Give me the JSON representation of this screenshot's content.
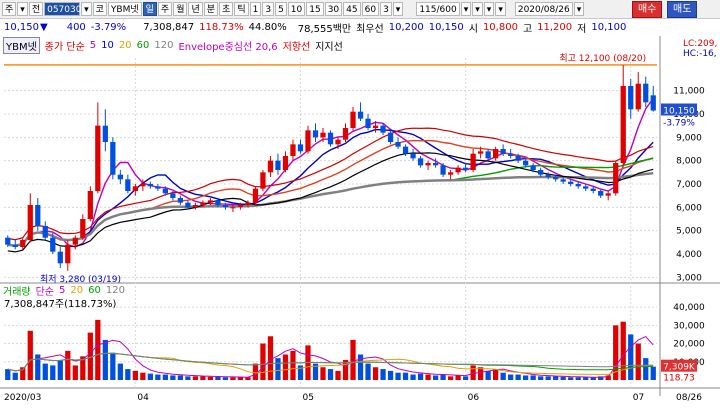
{
  "toolbar": {
    "items": [
      "주",
      "▾",
      "전",
      "057030",
      "▾",
      "코",
      "YBM넷",
      "일",
      "주",
      "월",
      "년",
      "분",
      "초",
      "틱",
      "1",
      "3",
      "5",
      "10",
      "15",
      "30",
      "45",
      "60",
      "3",
      "▾",
      "115/600",
      "▾",
      "▾",
      "▾",
      "▾",
      "2020/08/26",
      "▾"
    ],
    "period_value": "1",
    "date": "2020/08/26",
    "buy_label": "매수",
    "sell_label": "매도"
  },
  "quote": {
    "price": "10,150",
    "arrow": "▼",
    "change": "400",
    "change_pct": "-3.79%",
    "volume": "7,308,847",
    "volume_pct": "118.73%",
    "turnover": "44.80%",
    "amount": "78,555백만",
    "best_label": "최우선",
    "best_ask": "10,200",
    "best_bid": "10,150",
    "open_label": "시",
    "open": "10,800",
    "high_label": "고",
    "high": "11,200",
    "low_label": "저",
    "low": "10,100"
  },
  "price_legend": {
    "name": "YBM넷",
    "ma_label": "종가 단순",
    "ma_periods": [
      "5",
      "10",
      "20",
      "60",
      "120"
    ],
    "ma_colors": [
      "#c000c0",
      "#0000c8",
      "#e0a000",
      "#00a000",
      "#808080"
    ],
    "envelope_label": "Envelope중심선 20,6",
    "resistance_label": "저항선",
    "support_label": "지지선"
  },
  "volume_legend": {
    "label": "거래량",
    "ma_label": "단순",
    "ma_periods": [
      "5",
      "20",
      "60",
      "120"
    ],
    "value": "7,308,847주(118.73%)"
  },
  "annotations": {
    "high_note": "최고 12,100 (08/20)",
    "low_note": "최저 3,280 (03/19)",
    "lc_label": "LC:209,",
    "hc_label": "HC:-16,",
    "current_price_tag": "10,150",
    "current_pct_tag": "-3.79%",
    "volume_tag": "7,309K",
    "volume_pct_tag": "118.73"
  },
  "axis": {
    "price_ticks": [
      "11,000",
      "10,000",
      "9,000",
      "8,000",
      "7,000",
      "6,000",
      "5,000",
      "4,000",
      "3,000"
    ],
    "volume_ticks": [
      "40,000",
      "30,000",
      "20,000",
      "10,000"
    ],
    "date_ticks": [
      "2020/03",
      "04",
      "05",
      "06",
      "07",
      "08",
      "08/26"
    ]
  },
  "chart_data": {
    "type": "candlestick",
    "ylim": [
      2800,
      12400
    ],
    "volume_ylim": [
      0,
      45000
    ],
    "note": "daily OHLC (KRW), volume in thousand shares",
    "candles": [
      [
        4700,
        4800,
        4300,
        4400,
        6000
      ],
      [
        4400,
        4600,
        4200,
        4300,
        4000
      ],
      [
        4300,
        4700,
        4200,
        4600,
        7000
      ],
      [
        4600,
        6600,
        4500,
        6100,
        27000
      ],
      [
        6100,
        6400,
        5000,
        5200,
        14000
      ],
      [
        5200,
        5400,
        4600,
        4700,
        9000
      ],
      [
        4700,
        4900,
        4000,
        4100,
        8000
      ],
      [
        4100,
        4300,
        3400,
        3600,
        11000
      ],
      [
        3600,
        4600,
        3280,
        4400,
        16000
      ],
      [
        4400,
        4800,
        4200,
        4700,
        8000
      ],
      [
        4700,
        5700,
        4600,
        5500,
        13000
      ],
      [
        5500,
        6900,
        5400,
        6700,
        26000
      ],
      [
        6700,
        10500,
        6600,
        9500,
        33000
      ],
      [
        9500,
        10200,
        8400,
        8800,
        22000
      ],
      [
        8800,
        9000,
        7200,
        7400,
        15000
      ],
      [
        7400,
        7600,
        7000,
        7200,
        9000
      ],
      [
        7200,
        7400,
        6600,
        6700,
        6000
      ],
      [
        6700,
        7000,
        6500,
        6900,
        5000
      ],
      [
        6900,
        7200,
        6700,
        7000,
        4000
      ],
      [
        7000,
        7100,
        6800,
        6900,
        3500
      ],
      [
        6900,
        7000,
        6700,
        6800,
        3000
      ],
      [
        6800,
        6900,
        6500,
        6600,
        3000
      ],
      [
        6600,
        6700,
        6300,
        6400,
        2500
      ],
      [
        6400,
        6500,
        6100,
        6200,
        2500
      ],
      [
        6200,
        6300,
        5900,
        6000,
        2000
      ],
      [
        6000,
        6200,
        5900,
        6100,
        2000
      ],
      [
        6100,
        6300,
        6000,
        6200,
        2000
      ],
      [
        6200,
        6400,
        6100,
        6300,
        1800
      ],
      [
        6300,
        6400,
        6000,
        6100,
        1800
      ],
      [
        6100,
        6200,
        5900,
        6000,
        1500
      ],
      [
        6000,
        6100,
        5800,
        6000,
        1500
      ],
      [
        6000,
        6200,
        5900,
        6100,
        1500
      ],
      [
        6100,
        6300,
        6000,
        6200,
        1500
      ],
      [
        6200,
        6900,
        6100,
        6800,
        9000
      ],
      [
        6800,
        7600,
        6700,
        7500,
        20000
      ],
      [
        7500,
        8200,
        7300,
        8000,
        24000
      ],
      [
        8000,
        8300,
        7400,
        7600,
        12000
      ],
      [
        7600,
        8400,
        7500,
        8200,
        14000
      ],
      [
        8200,
        8900,
        8000,
        8700,
        16000
      ],
      [
        8700,
        8900,
        8300,
        8400,
        8000
      ],
      [
        8400,
        9500,
        8300,
        9300,
        19000
      ],
      [
        9300,
        9600,
        8800,
        9000,
        9000
      ],
      [
        9000,
        9400,
        8800,
        9200,
        7000
      ],
      [
        9200,
        9300,
        8600,
        8700,
        6000
      ],
      [
        8700,
        9000,
        8500,
        8900,
        5000
      ],
      [
        8900,
        9600,
        8800,
        9400,
        11000
      ],
      [
        9400,
        10300,
        9300,
        10100,
        22000
      ],
      [
        10100,
        10500,
        9700,
        9800,
        14000
      ],
      [
        9800,
        10000,
        9300,
        9400,
        9000
      ],
      [
        9400,
        9700,
        9200,
        9500,
        7000
      ],
      [
        9500,
        9600,
        9100,
        9200,
        6000
      ],
      [
        9200,
        9300,
        8700,
        8800,
        5000
      ],
      [
        8800,
        9000,
        8500,
        8600,
        4000
      ],
      [
        8600,
        8700,
        8200,
        8300,
        4000
      ],
      [
        8300,
        8500,
        8000,
        8100,
        3000
      ],
      [
        8100,
        8200,
        7700,
        7800,
        3500
      ],
      [
        7800,
        8000,
        7600,
        7900,
        3000
      ],
      [
        7900,
        8100,
        7700,
        7800,
        2500
      ],
      [
        7800,
        7900,
        7300,
        7400,
        3000
      ],
      [
        7400,
        7600,
        7200,
        7500,
        2000
      ],
      [
        7500,
        7800,
        7400,
        7700,
        2500
      ],
      [
        7700,
        7900,
        7500,
        7600,
        2000
      ],
      [
        7600,
        8500,
        7500,
        8300,
        8000
      ],
      [
        8300,
        8600,
        8100,
        8400,
        7000
      ],
      [
        8400,
        8500,
        8000,
        8100,
        5000
      ],
      [
        8100,
        8600,
        8000,
        8500,
        6000
      ],
      [
        8500,
        8700,
        8200,
        8300,
        4000
      ],
      [
        8300,
        8500,
        8100,
        8200,
        3000
      ],
      [
        8200,
        8300,
        7900,
        8000,
        3000
      ],
      [
        8000,
        8100,
        7700,
        7800,
        2500
      ],
      [
        7800,
        7900,
        7500,
        7600,
        2500
      ],
      [
        7600,
        7700,
        7300,
        7400,
        2000
      ],
      [
        7400,
        7500,
        7200,
        7300,
        2000
      ],
      [
        7300,
        7400,
        7100,
        7200,
        2000
      ],
      [
        7200,
        7300,
        7000,
        7100,
        1800
      ],
      [
        7100,
        7200,
        6900,
        7000,
        1500
      ],
      [
        7000,
        7100,
        6800,
        6900,
        1500
      ],
      [
        6900,
        7000,
        6700,
        6800,
        1500
      ],
      [
        6800,
        6900,
        6600,
        6700,
        1500
      ],
      [
        6700,
        6800,
        6400,
        6500,
        2000
      ],
      [
        6500,
        6700,
        6300,
        6600,
        2500
      ],
      [
        6600,
        8000,
        6500,
        7900,
        30000
      ],
      [
        7900,
        12100,
        7800,
        11200,
        32000
      ],
      [
        11200,
        11500,
        9800,
        10200,
        25000
      ],
      [
        10200,
        11800,
        10100,
        11300,
        20000
      ],
      [
        11300,
        11600,
        10300,
        10500,
        12000
      ],
      [
        10800,
        11200,
        10100,
        10150,
        7309
      ]
    ]
  }
}
